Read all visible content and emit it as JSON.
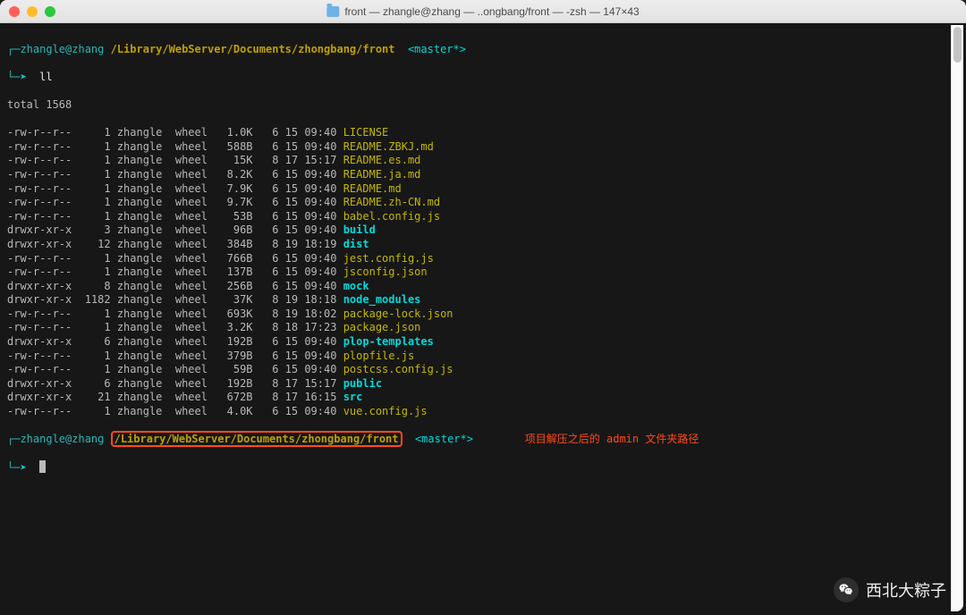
{
  "titlebar": {
    "title": "front — zhangle@zhang — ..ongbang/front — -zsh — 147×43"
  },
  "prompt1": {
    "user": "zhangle@zhang",
    "path": "/Library/WebServer/Documents/zhongbang/front",
    "branch": "<master*>",
    "cmd": "ll"
  },
  "total": "total 1568",
  "files": [
    {
      "perm": "-rw-r--r--",
      "links": "1",
      "owner": "zhangle",
      "group": "wheel",
      "size": "1.0K",
      "m": "6",
      "d": "15",
      "t": "09:40",
      "name": "LICENSE",
      "kind": "file"
    },
    {
      "perm": "-rw-r--r--",
      "links": "1",
      "owner": "zhangle",
      "group": "wheel",
      "size": "588B",
      "m": "6",
      "d": "15",
      "t": "09:40",
      "name": "README.ZBKJ.md",
      "kind": "file"
    },
    {
      "perm": "-rw-r--r--",
      "links": "1",
      "owner": "zhangle",
      "group": "wheel",
      "size": "15K",
      "m": "8",
      "d": "17",
      "t": "15:17",
      "name": "README.es.md",
      "kind": "file"
    },
    {
      "perm": "-rw-r--r--",
      "links": "1",
      "owner": "zhangle",
      "group": "wheel",
      "size": "8.2K",
      "m": "6",
      "d": "15",
      "t": "09:40",
      "name": "README.ja.md",
      "kind": "file"
    },
    {
      "perm": "-rw-r--r--",
      "links": "1",
      "owner": "zhangle",
      "group": "wheel",
      "size": "7.9K",
      "m": "6",
      "d": "15",
      "t": "09:40",
      "name": "README.md",
      "kind": "file"
    },
    {
      "perm": "-rw-r--r--",
      "links": "1",
      "owner": "zhangle",
      "group": "wheel",
      "size": "9.7K",
      "m": "6",
      "d": "15",
      "t": "09:40",
      "name": "README.zh-CN.md",
      "kind": "file"
    },
    {
      "perm": "-rw-r--r--",
      "links": "1",
      "owner": "zhangle",
      "group": "wheel",
      "size": "53B",
      "m": "6",
      "d": "15",
      "t": "09:40",
      "name": "babel.config.js",
      "kind": "file"
    },
    {
      "perm": "drwxr-xr-x",
      "links": "3",
      "owner": "zhangle",
      "group": "wheel",
      "size": "96B",
      "m": "6",
      "d": "15",
      "t": "09:40",
      "name": "build",
      "kind": "dir"
    },
    {
      "perm": "drwxr-xr-x",
      "links": "12",
      "owner": "zhangle",
      "group": "wheel",
      "size": "384B",
      "m": "8",
      "d": "19",
      "t": "18:19",
      "name": "dist",
      "kind": "dir"
    },
    {
      "perm": "-rw-r--r--",
      "links": "1",
      "owner": "zhangle",
      "group": "wheel",
      "size": "766B",
      "m": "6",
      "d": "15",
      "t": "09:40",
      "name": "jest.config.js",
      "kind": "file"
    },
    {
      "perm": "-rw-r--r--",
      "links": "1",
      "owner": "zhangle",
      "group": "wheel",
      "size": "137B",
      "m": "6",
      "d": "15",
      "t": "09:40",
      "name": "jsconfig.json",
      "kind": "file"
    },
    {
      "perm": "drwxr-xr-x",
      "links": "8",
      "owner": "zhangle",
      "group": "wheel",
      "size": "256B",
      "m": "6",
      "d": "15",
      "t": "09:40",
      "name": "mock",
      "kind": "dir"
    },
    {
      "perm": "drwxr-xr-x",
      "links": "1182",
      "owner": "zhangle",
      "group": "wheel",
      "size": "37K",
      "m": "8",
      "d": "19",
      "t": "18:18",
      "name": "node_modules",
      "kind": "dir"
    },
    {
      "perm": "-rw-r--r--",
      "links": "1",
      "owner": "zhangle",
      "group": "wheel",
      "size": "693K",
      "m": "8",
      "d": "19",
      "t": "18:02",
      "name": "package-lock.json",
      "kind": "file"
    },
    {
      "perm": "-rw-r--r--",
      "links": "1",
      "owner": "zhangle",
      "group": "wheel",
      "size": "3.2K",
      "m": "8",
      "d": "18",
      "t": "17:23",
      "name": "package.json",
      "kind": "file"
    },
    {
      "perm": "drwxr-xr-x",
      "links": "6",
      "owner": "zhangle",
      "group": "wheel",
      "size": "192B",
      "m": "6",
      "d": "15",
      "t": "09:40",
      "name": "plop-templates",
      "kind": "dir"
    },
    {
      "perm": "-rw-r--r--",
      "links": "1",
      "owner": "zhangle",
      "group": "wheel",
      "size": "379B",
      "m": "6",
      "d": "15",
      "t": "09:40",
      "name": "plopfile.js",
      "kind": "file"
    },
    {
      "perm": "-rw-r--r--",
      "links": "1",
      "owner": "zhangle",
      "group": "wheel",
      "size": "59B",
      "m": "6",
      "d": "15",
      "t": "09:40",
      "name": "postcss.config.js",
      "kind": "file"
    },
    {
      "perm": "drwxr-xr-x",
      "links": "6",
      "owner": "zhangle",
      "group": "wheel",
      "size": "192B",
      "m": "8",
      "d": "17",
      "t": "15:17",
      "name": "public",
      "kind": "dir"
    },
    {
      "perm": "drwxr-xr-x",
      "links": "21",
      "owner": "zhangle",
      "group": "wheel",
      "size": "672B",
      "m": "8",
      "d": "17",
      "t": "16:15",
      "name": "src",
      "kind": "dir"
    },
    {
      "perm": "-rw-r--r--",
      "links": "1",
      "owner": "zhangle",
      "group": "wheel",
      "size": "4.0K",
      "m": "6",
      "d": "15",
      "t": "09:40",
      "name": "vue.config.js",
      "kind": "file"
    }
  ],
  "prompt2": {
    "user": "zhangle@zhang",
    "path": "/Library/WebServer/Documents/zhongbang/front",
    "branch": "<master*>",
    "annotation": "项目解压之后的 admin 文件夹路径"
  },
  "watermark": {
    "text": "西北大粽子"
  }
}
